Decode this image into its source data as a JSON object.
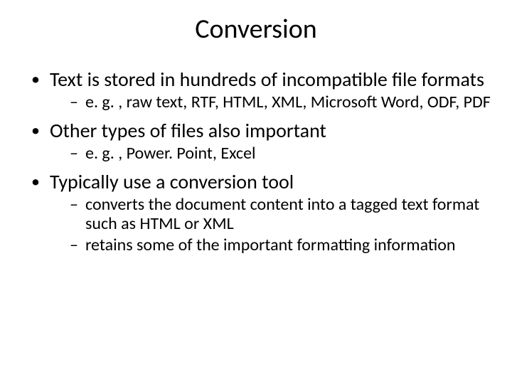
{
  "title": "Conversion",
  "bullets": [
    {
      "text": "Text is stored in hundreds of incompatible file formats",
      "sub": [
        "e. g. , raw text, RTF, HTML, XML, Microsoft Word, ODF, PDF"
      ]
    },
    {
      "text": "Other types of files also important",
      "sub": [
        "e. g. , Power. Point, Excel"
      ]
    },
    {
      "text": "Typically use a conversion tool",
      "sub": [
        "converts the document content into a tagged text format such as HTML or XML",
        "retains some of the important formatting information"
      ]
    }
  ]
}
